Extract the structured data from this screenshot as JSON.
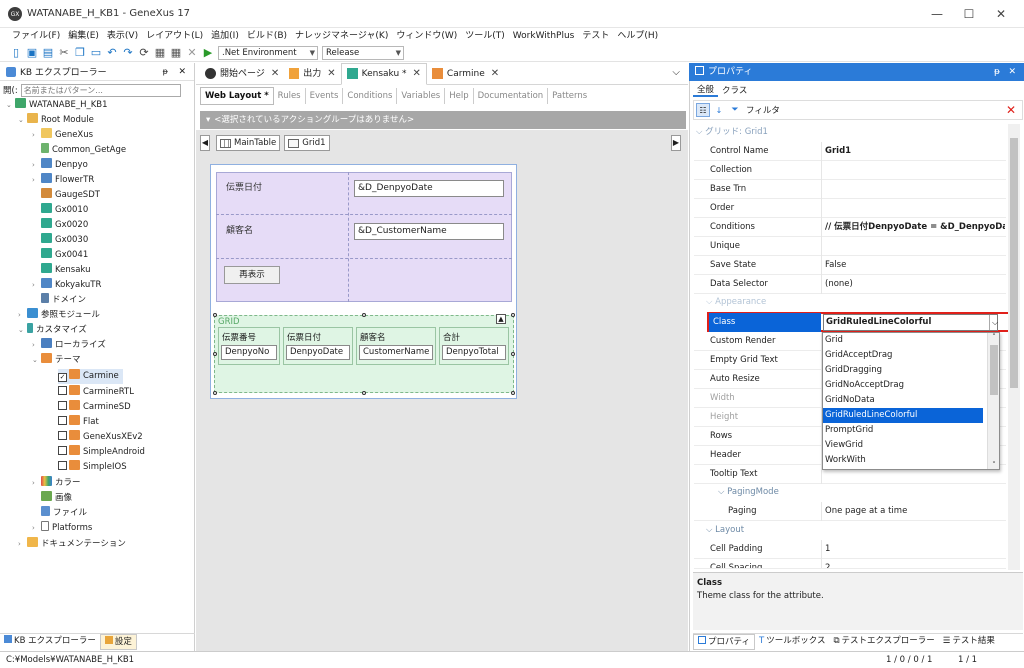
{
  "window": {
    "title": "WATANABE_H_KB1 - GeneXus 17",
    "logo_text": "GX",
    "minimize": "—",
    "maximize": "☐",
    "close": "✕"
  },
  "menu": [
    "ファイル(F)",
    "編集(E)",
    "表示(V)",
    "レイアウト(L)",
    "追加(I)",
    "ビルド(B)",
    "ナレッジマネージャ(K)",
    "ウィンドウ(W)",
    "ツール(T)",
    "WorkWithPlus",
    "テスト",
    "ヘルプ(H)"
  ],
  "toolbar": {
    "environment": ".Net Environment",
    "configuration": "Release"
  },
  "kb_explorer": {
    "title": "KB エクスプローラー",
    "pin": "ᵽ",
    "close": "✕",
    "search_label": "開(:",
    "search_placeholder": "名前またはパターン...",
    "tree": [
      {
        "label": "WATANABE_H_KB1",
        "icon": "kb-icon"
      },
      {
        "label": "Root Module",
        "icon": "module-icon"
      },
      {
        "label": "GeneXus",
        "icon": "folder-icon"
      },
      {
        "label": "Common_GetAge",
        "icon": "procedure-icon"
      },
      {
        "label": "Denpyo",
        "icon": "transaction-icon"
      },
      {
        "label": "FlowerTR",
        "icon": "transaction-icon"
      },
      {
        "label": "GaugeSDT",
        "icon": "sdt-icon"
      },
      {
        "label": "Gx0010",
        "icon": "webpanel-icon"
      },
      {
        "label": "Gx0020",
        "icon": "webpanel-icon"
      },
      {
        "label": "Gx0030",
        "icon": "webpanel-icon"
      },
      {
        "label": "Gx0041",
        "icon": "webpanel-icon"
      },
      {
        "label": "Kensaku",
        "icon": "webpanel-icon"
      },
      {
        "label": "KokyakuTR",
        "icon": "transaction-icon"
      },
      {
        "label": "ドメイン",
        "icon": "domain-icon"
      },
      {
        "label": "参照モジュール",
        "icon": "reference-icon"
      },
      {
        "label": "カスタマイズ",
        "icon": "customize-icon"
      },
      {
        "label": "ローカライズ",
        "icon": "localize-icon"
      },
      {
        "label": "テーマ",
        "icon": "theme-icon"
      },
      {
        "label": "Carmine",
        "icon": "theme-icon"
      },
      {
        "label": "CarmineRTL",
        "icon": "theme-icon"
      },
      {
        "label": "CarmineSD",
        "icon": "theme-icon"
      },
      {
        "label": "Flat",
        "icon": "theme-icon"
      },
      {
        "label": "GeneXusXEv2",
        "icon": "theme-icon"
      },
      {
        "label": "SimpleAndroid",
        "icon": "theme-icon"
      },
      {
        "label": "SimpleIOS",
        "icon": "theme-icon"
      },
      {
        "label": "カラー",
        "icon": "color-icon"
      },
      {
        "label": "画像",
        "icon": "image-icon"
      },
      {
        "label": "ファイル",
        "icon": "file-icon"
      },
      {
        "label": "Platforms",
        "icon": "platform-icon"
      },
      {
        "label": "ドキュメンテーション",
        "icon": "doc-icon"
      }
    ],
    "bottom_tabs": [
      "KB エクスプローラー",
      "設定"
    ]
  },
  "editor": {
    "tabs": [
      {
        "label": "開始ページ",
        "icon": "gx-icon"
      },
      {
        "label": "出力",
        "icon": "output-icon"
      },
      {
        "label": "Kensaku *",
        "icon": "webpanel-icon"
      },
      {
        "label": "Carmine",
        "icon": "theme-icon"
      }
    ],
    "tab_close": "✕",
    "overflow": "⌵",
    "subtabs": [
      "Web Layout *",
      "Rules",
      "Events",
      "Conditions",
      "Variables",
      "Help",
      "Documentation",
      "Patterns"
    ],
    "action_bar": "<選択されているアクショングループはありません>",
    "breadcrumbs": [
      "MainTable",
      "Grid1"
    ],
    "nav_left": "◀",
    "nav_right": "▶",
    "form": {
      "label_date": "伝票日付",
      "value_date": "&D_DenpyoDate",
      "label_customer": "顧客名",
      "value_customer": "&D_CustomerName",
      "refresh_button": "再表示"
    },
    "grid": {
      "caption": "GRID",
      "columns": [
        {
          "header": "伝票番号",
          "value": "DenpyoNo"
        },
        {
          "header": "伝票日付",
          "value": "DenpyoDate"
        },
        {
          "header": "顧客名",
          "value": "CustomerName"
        },
        {
          "header": "合計",
          "value": "DenpyoTotal"
        }
      ]
    }
  },
  "properties": {
    "title": "プロパティ",
    "tabs": [
      "全般",
      "クラス"
    ],
    "filter_label": "フィルタ",
    "group_grid": "グリッド: Grid1",
    "rows": [
      {
        "name": "Control Name",
        "value": "Grid1"
      },
      {
        "name": "Collection",
        "value": ""
      },
      {
        "name": "Base Trn",
        "value": ""
      },
      {
        "name": "Order",
        "value": ""
      },
      {
        "name": "Conditions",
        "value": "// 伝票日付DenpyoDate = &D_DenpyoDat..."
      },
      {
        "name": "Unique",
        "value": ""
      },
      {
        "name": "Save State",
        "value": "False"
      },
      {
        "name": "Data Selector",
        "value": "(none)"
      }
    ],
    "group_appearance": "Appearance",
    "class_row": {
      "name": "Class",
      "value": "GridRuledLineColorful"
    },
    "appearance_rows": [
      {
        "name": "Custom Render",
        "disabled": false
      },
      {
        "name": "Empty Grid Text",
        "disabled": false
      },
      {
        "name": "Auto Resize",
        "disabled": false
      },
      {
        "name": "Width",
        "disabled": true
      },
      {
        "name": "Height",
        "disabled": true
      },
      {
        "name": "Rows",
        "disabled": false
      },
      {
        "name": "Header",
        "disabled": false
      },
      {
        "name": "Tooltip Text",
        "disabled": false
      }
    ],
    "group_paging": "PagingMode",
    "paging_row": {
      "name": "Paging",
      "value": "One page at a time"
    },
    "group_layout": "Layout",
    "layout_rows": [
      {
        "name": "Cell Padding",
        "value": "1"
      },
      {
        "name": "Cell Spacing",
        "value": "2"
      }
    ],
    "class_options": [
      "Grid",
      "GridAcceptDrag",
      "GridDragging",
      "GridNoAcceptDrag",
      "GridNoData",
      "GridRuledLineColorful",
      "PromptGrid",
      "ViewGrid",
      "WorkWith"
    ],
    "selected_option": "GridRuledLineColorful",
    "help_title": "Class",
    "help_text": "Theme class for the attribute.",
    "bottom_tabs": [
      "プロパティ",
      "ツールボックス",
      "テストエクスプローラー",
      "テスト結果"
    ]
  },
  "statusbar": {
    "path": "C:¥Models¥WATANABE_H_KB1",
    "counters": "1 / 0 / 0 / 1",
    "pages": "1 / 1"
  },
  "colors": {
    "accent": "#2b7bd8",
    "highlight_red": "#e0201a",
    "form_purple": "#e6dcf7",
    "grid_green": "#dff5e4"
  }
}
